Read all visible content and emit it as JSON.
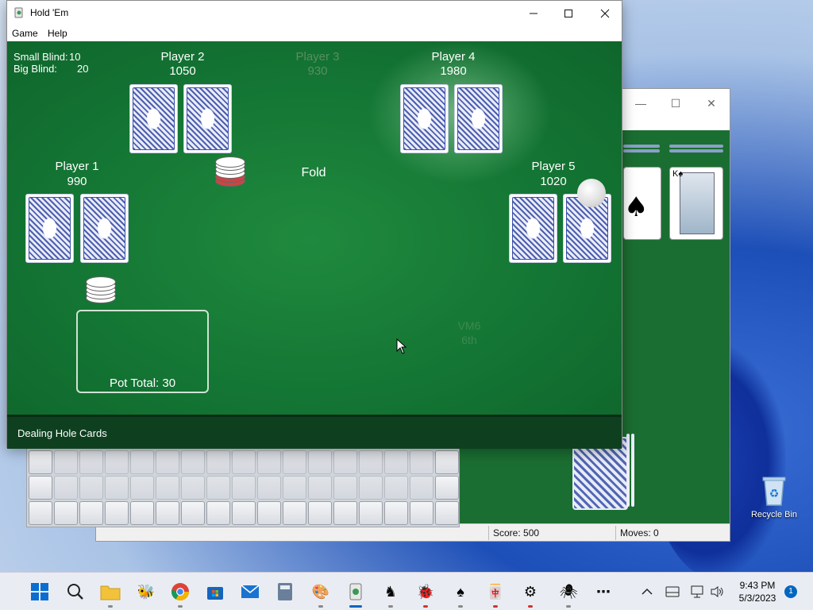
{
  "holdem": {
    "title": "Hold 'Em",
    "menu": [
      "Game",
      "Help"
    ],
    "blinds": {
      "small_label": "Small Blind:",
      "small": "10",
      "big_label": "Big Blind:",
      "big": "20"
    },
    "players": [
      {
        "name": "Player 1",
        "chips": "990"
      },
      {
        "name": "Player 2",
        "chips": "1050"
      },
      {
        "name": "Player 3",
        "chips": "930"
      },
      {
        "name": "Player 4",
        "chips": "1980"
      },
      {
        "name": "Player 5",
        "chips": "1020"
      }
    ],
    "action_text": "Fold",
    "pot_total": "Pot Total: 30",
    "watermark_1": "VM6",
    "watermark_2": "6th",
    "status": "Dealing Hole Cards"
  },
  "solitaire": {
    "score": "Score: 500",
    "moves": "Moves:  0"
  },
  "desktop": {
    "recycle_bin": "Recycle Bin"
  },
  "taskbar": {
    "time": "9:43 PM",
    "date": "5/3/2023",
    "notifications": "1",
    "icons": [
      "windows-start",
      "search",
      "file-explorer",
      "bee-app",
      "chrome",
      "microsoft-store",
      "mail",
      "calculator",
      "paint",
      "holdem",
      "chess-game",
      "ladybug-game",
      "spider-game",
      "mahjong",
      "gear-game",
      "spider-solitaire",
      "more"
    ]
  }
}
